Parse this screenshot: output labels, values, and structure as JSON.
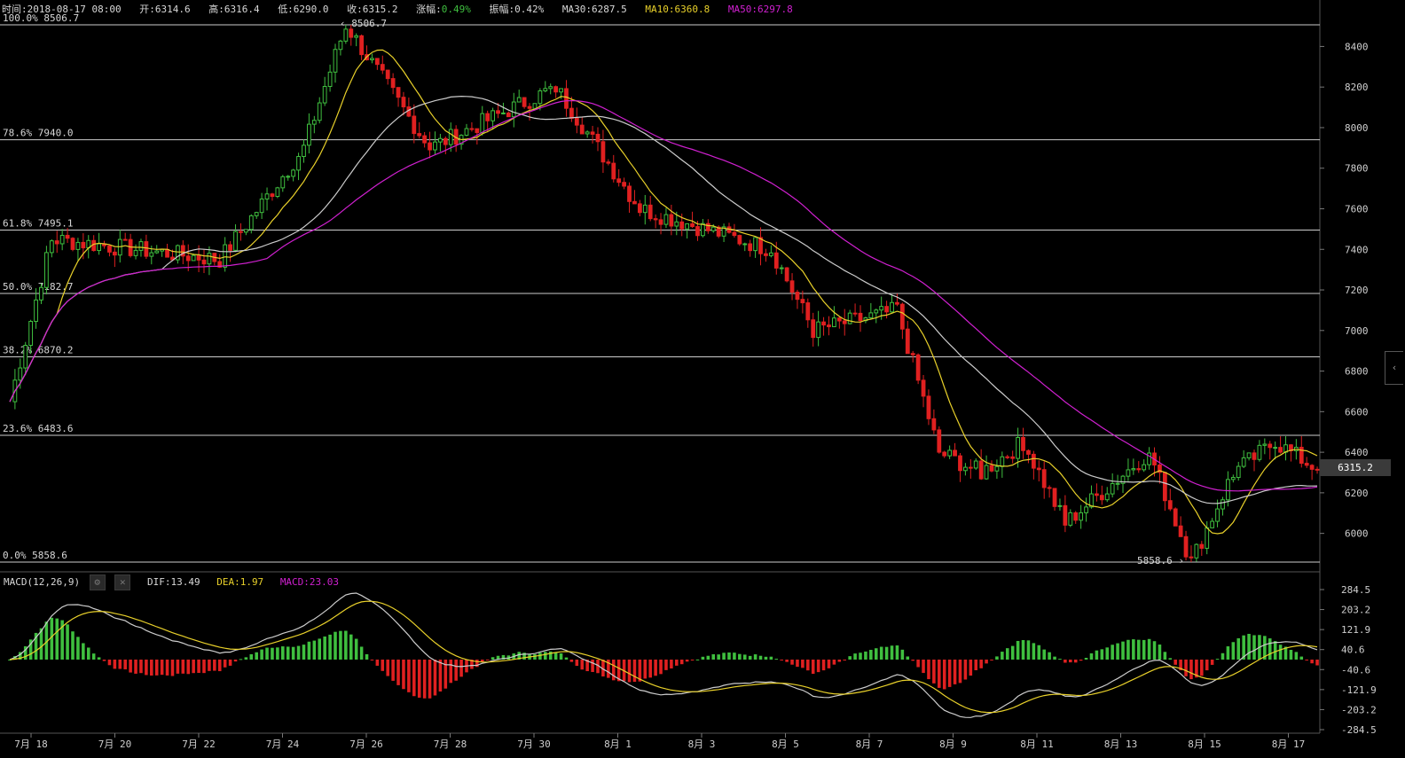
{
  "header": {
    "time": "时间:2018-08-17 08:00",
    "open": "开:6314.6",
    "high": "高:6316.4",
    "low": "低:6290.0",
    "close": "收:6315.2",
    "change_label": "涨幅:",
    "change_value": "0.49%",
    "amplitude": "振幅:0.42%",
    "ma30": "MA30:6287.5",
    "ma10": "MA10:6360.8",
    "ma50": "MA50:6297.8"
  },
  "colors": {
    "up": "#3fbf3f",
    "down": "#e02020",
    "ma10": "#e8d02a",
    "ma30": "#cccccc",
    "ma50": "#d020d0",
    "grid": "#cccccc",
    "dea": "#e8d02a",
    "dif": "#cccccc",
    "macd_label": "#d020d0"
  },
  "fib_levels": [
    {
      "label": "100.0% 8506.7",
      "value": 8506.7
    },
    {
      "label": "78.6% 7940.0",
      "value": 7940.0
    },
    {
      "label": "61.8% 7495.1",
      "value": 7495.1
    },
    {
      "label": "50.0% 7182.7",
      "value": 7182.7
    },
    {
      "label": "38.2% 6870.2",
      "value": 6870.2
    },
    {
      "label": "23.6% 6483.6",
      "value": 6483.6
    },
    {
      "label": "0.0% 5858.6",
      "value": 5858.6
    }
  ],
  "high_marker": "8506.7",
  "low_marker": "5858.6",
  "current_price": "6315.2",
  "price_axis_ticks": [
    "8400",
    "8200",
    "8000",
    "7800",
    "7600",
    "7400",
    "7200",
    "7000",
    "6800",
    "6600",
    "6400",
    "6200",
    "6000"
  ],
  "macd_axis_ticks": [
    "284.5",
    "203.2",
    "121.9",
    "40.6",
    "-40.6",
    "-121.9",
    "-203.2",
    "-284.5"
  ],
  "date_axis_ticks": [
    "7月 18",
    "7月 20",
    "7月 22",
    "7月 24",
    "7月 26",
    "7月 28",
    "7月 30",
    "8月 1",
    "8月 3",
    "8月 5",
    "8月 7",
    "8月 9",
    "8月 11",
    "8月 13",
    "8月 15",
    "8月 17"
  ],
  "macd_header": {
    "name": "MACD(12,26,9)",
    "dif": "DIF:13.49",
    "dea": "DEA:1.97",
    "macd": "MACD:23.03"
  },
  "side_tab": "‹",
  "chart_data": {
    "type": "candlestick",
    "x_range": [
      "7月 17",
      "8月 17"
    ],
    "ylim": [
      5858.6,
      8506.7
    ],
    "key_points": [
      {
        "date": "7月 17",
        "price": 6650
      },
      {
        "date": "7月 18",
        "price": 7450
      },
      {
        "date": "7月 22",
        "price": 7350
      },
      {
        "date": "7月 24",
        "price": 7900
      },
      {
        "date": "7月 25",
        "price": 8506.7
      },
      {
        "date": "7月 27",
        "price": 7900
      },
      {
        "date": "7月 30",
        "price": 8200
      },
      {
        "date": "8月 1",
        "price": 7600
      },
      {
        "date": "8月 4",
        "price": 7400
      },
      {
        "date": "8月 5",
        "price": 7000
      },
      {
        "date": "8月 7",
        "price": 7100
      },
      {
        "date": "8月 8",
        "price": 6400
      },
      {
        "date": "8月 9",
        "price": 6300
      },
      {
        "date": "8月 10",
        "price": 6450
      },
      {
        "date": "8月 11",
        "price": 6050
      },
      {
        "date": "8月 13",
        "price": 6400
      },
      {
        "date": "8月 14",
        "price": 5858.6
      },
      {
        "date": "8月 15",
        "price": 6300
      },
      {
        "date": "8月 16",
        "price": 6450
      },
      {
        "date": "8月 17",
        "price": 6315.2
      }
    ]
  }
}
